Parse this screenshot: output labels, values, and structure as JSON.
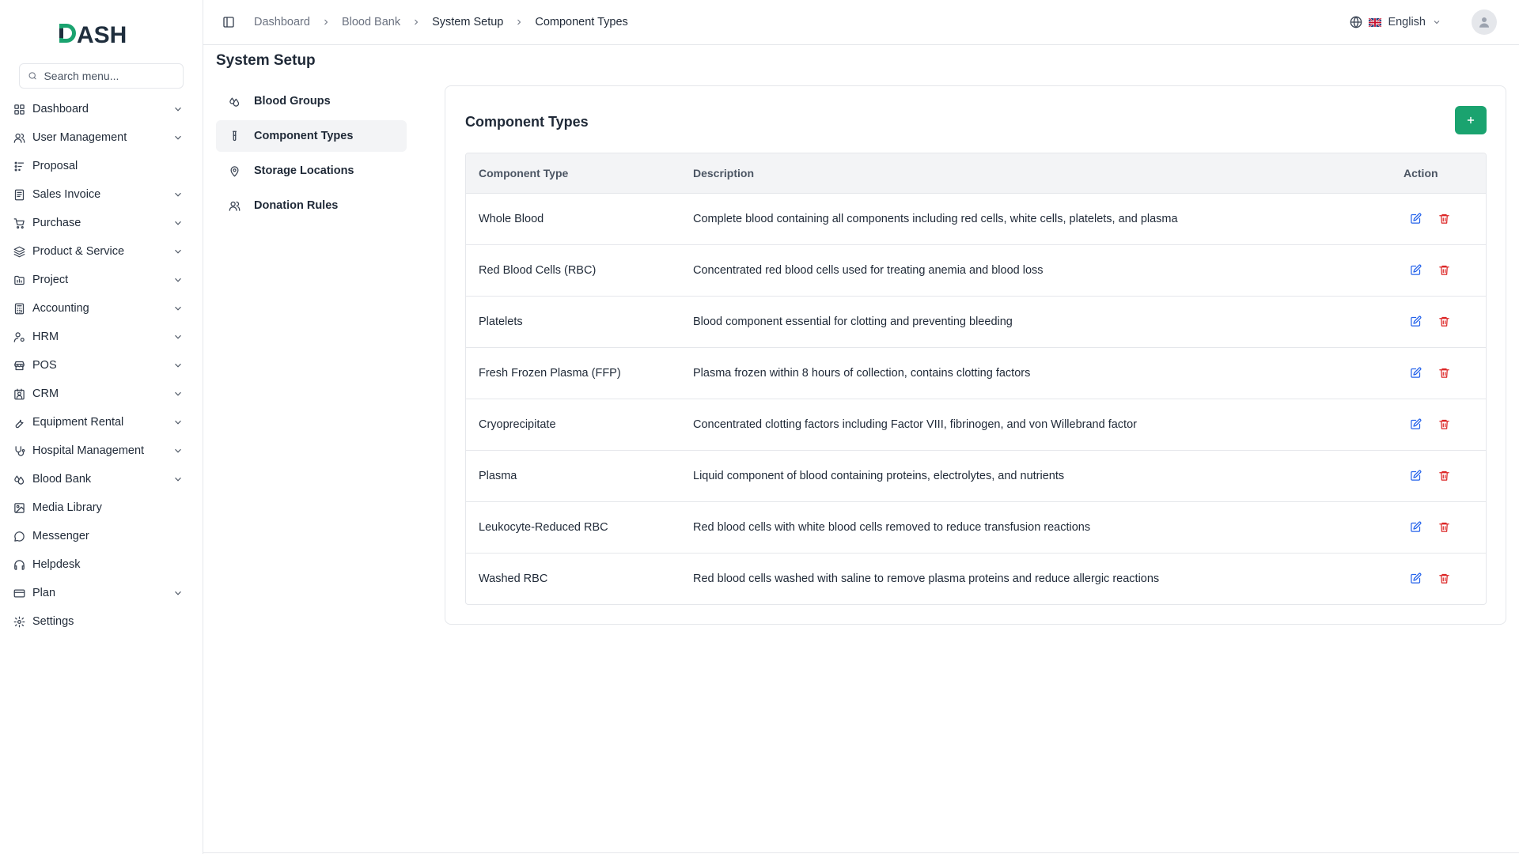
{
  "app": {
    "logo_text": "DASH",
    "brand_color": "#1aa36f",
    "logo_color": "#1f2e3d"
  },
  "sidebar": {
    "search_placeholder": "Search menu...",
    "items": [
      {
        "label": "Dashboard",
        "icon": "grid-icon",
        "expandable": true
      },
      {
        "label": "User Management",
        "icon": "users-icon",
        "expandable": true
      },
      {
        "label": "Proposal",
        "icon": "proposal-icon",
        "expandable": false
      },
      {
        "label": "Sales Invoice",
        "icon": "invoice-icon",
        "expandable": true
      },
      {
        "label": "Purchase",
        "icon": "cart-icon",
        "expandable": true
      },
      {
        "label": "Product & Service",
        "icon": "layers-icon",
        "expandable": true
      },
      {
        "label": "Project",
        "icon": "folder-icon",
        "expandable": true
      },
      {
        "label": "Accounting",
        "icon": "calculator-icon",
        "expandable": true
      },
      {
        "label": "HRM",
        "icon": "user-cog-icon",
        "expandable": true
      },
      {
        "label": "POS",
        "icon": "store-icon",
        "expandable": true
      },
      {
        "label": "CRM",
        "icon": "contact-icon",
        "expandable": true
      },
      {
        "label": "Equipment Rental",
        "icon": "wrench-icon",
        "expandable": true
      },
      {
        "label": "Hospital Management",
        "icon": "stethoscope-icon",
        "expandable": true
      },
      {
        "label": "Blood Bank",
        "icon": "droplets-icon",
        "expandable": true
      },
      {
        "label": "Media Library",
        "icon": "image-icon",
        "expandable": false
      },
      {
        "label": "Messenger",
        "icon": "message-icon",
        "expandable": false
      },
      {
        "label": "Helpdesk",
        "icon": "headphones-icon",
        "expandable": false
      },
      {
        "label": "Plan",
        "icon": "card-icon",
        "expandable": true
      },
      {
        "label": "Settings",
        "icon": "gear-icon",
        "expandable": false
      }
    ]
  },
  "header": {
    "breadcrumbs": [
      "Dashboard",
      "Blood Bank",
      "System Setup",
      "Component Types"
    ],
    "language": "English"
  },
  "page": {
    "title": "System Setup",
    "subnav": [
      {
        "label": "Blood Groups",
        "icon": "droplets-icon",
        "active": false
      },
      {
        "label": "Component Types",
        "icon": "test-tube-icon",
        "active": true
      },
      {
        "label": "Storage Locations",
        "icon": "map-pin-icon",
        "active": false
      },
      {
        "label": "Donation Rules",
        "icon": "users-icon",
        "active": false
      }
    ],
    "card_title": "Component Types",
    "add_label": "+"
  },
  "table": {
    "headers": [
      "Component Type",
      "Description",
      "Action"
    ],
    "rows": [
      {
        "type": "Whole Blood",
        "description": "Complete blood containing all components including red cells, white cells, platelets, and plasma"
      },
      {
        "type": "Red Blood Cells (RBC)",
        "description": "Concentrated red blood cells used for treating anemia and blood loss"
      },
      {
        "type": "Platelets",
        "description": "Blood component essential for clotting and preventing bleeding"
      },
      {
        "type": "Fresh Frozen Plasma (FFP)",
        "description": "Plasma frozen within 8 hours of collection, contains clotting factors"
      },
      {
        "type": "Cryoprecipitate",
        "description": "Concentrated clotting factors including Factor VIII, fibrinogen, and von Willebrand factor"
      },
      {
        "type": "Plasma",
        "description": "Liquid component of blood containing proteins, electrolytes, and nutrients"
      },
      {
        "type": "Leukocyte-Reduced RBC",
        "description": "Red blood cells with white blood cells removed to reduce transfusion reactions"
      },
      {
        "type": "Washed RBC",
        "description": "Red blood cells washed with saline to remove plasma proteins and reduce allergic reactions"
      }
    ],
    "edit_color": "#2563eb",
    "delete_color": "#dc2626"
  }
}
